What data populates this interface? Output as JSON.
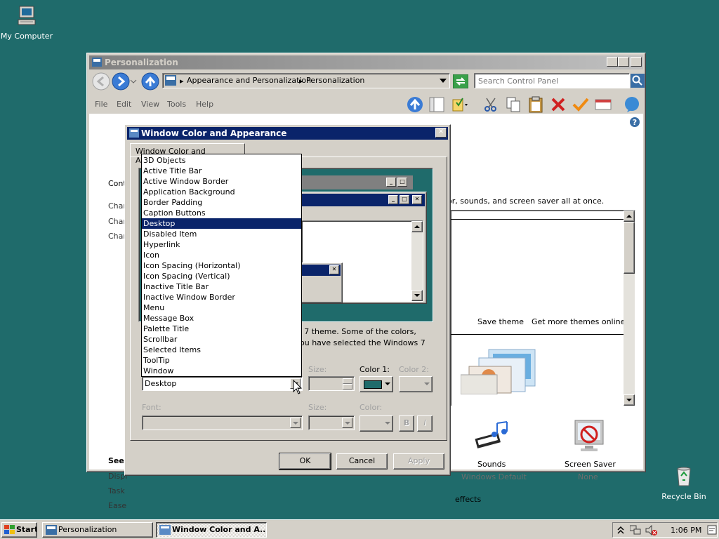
{
  "desktop": {
    "my_computer": "My Computer",
    "recycle_bin": "Recycle Bin"
  },
  "personalization": {
    "title": "Personalization",
    "breadcrumb": [
      "Appearance and Personalization",
      "Personalization"
    ],
    "search_placeholder": "Search Control Panel",
    "menu": [
      "File",
      "Edit",
      "View",
      "Tools",
      "Help"
    ],
    "left_partial": [
      "Cont",
      "Char",
      "Char",
      "Char"
    ],
    "see_also_partial": [
      "See",
      "Displ",
      "Task",
      "Ease"
    ],
    "desc_partial": "or, sounds, and screen saver all at once.",
    "save_theme": "Save theme",
    "get_more_themes": "Get more themes online",
    "sounds_label": "Sounds",
    "sounds_value": "Windows Default",
    "screensaver_label": "Screen Saver",
    "screensaver_value": "None",
    "effects_partial": "effects"
  },
  "dialog": {
    "title": "Window Color and Appearance",
    "tab": "Window Color and Appearance",
    "info_line1": "s 7 theme.  Some of the colors,",
    "info_line2": "ou have selected the Windows 7",
    "item_value": "Desktop",
    "size_label": "Size:",
    "color1_label": "Color 1:",
    "color2_label": "Color 2:",
    "font_label": "Font:",
    "font_size_label": "Size:",
    "font_color_label": "Color:",
    "bold_label": "B",
    "italic_label": "I",
    "ok": "OK",
    "cancel": "Cancel",
    "apply": "Apply",
    "color1_value": "#1f6b6b"
  },
  "dropdown_items": [
    "3D Objects",
    "Active Title Bar",
    "Active Window Border",
    "Application Background",
    "Border Padding",
    "Caption Buttons",
    "Desktop",
    "Disabled Item",
    "Hyperlink",
    "Icon",
    "Icon Spacing (Horizontal)",
    "Icon Spacing (Vertical)",
    "Inactive Title Bar",
    "Inactive Window Border",
    "Menu",
    "Message Box",
    "Palette Title",
    "Scrollbar",
    "Selected Items",
    "ToolTip",
    "Window"
  ],
  "dropdown_selected": "Desktop",
  "taskbar": {
    "start": "Start",
    "tasks": [
      "Personalization",
      "Window Color and A..."
    ],
    "clock": "1:06 PM"
  }
}
